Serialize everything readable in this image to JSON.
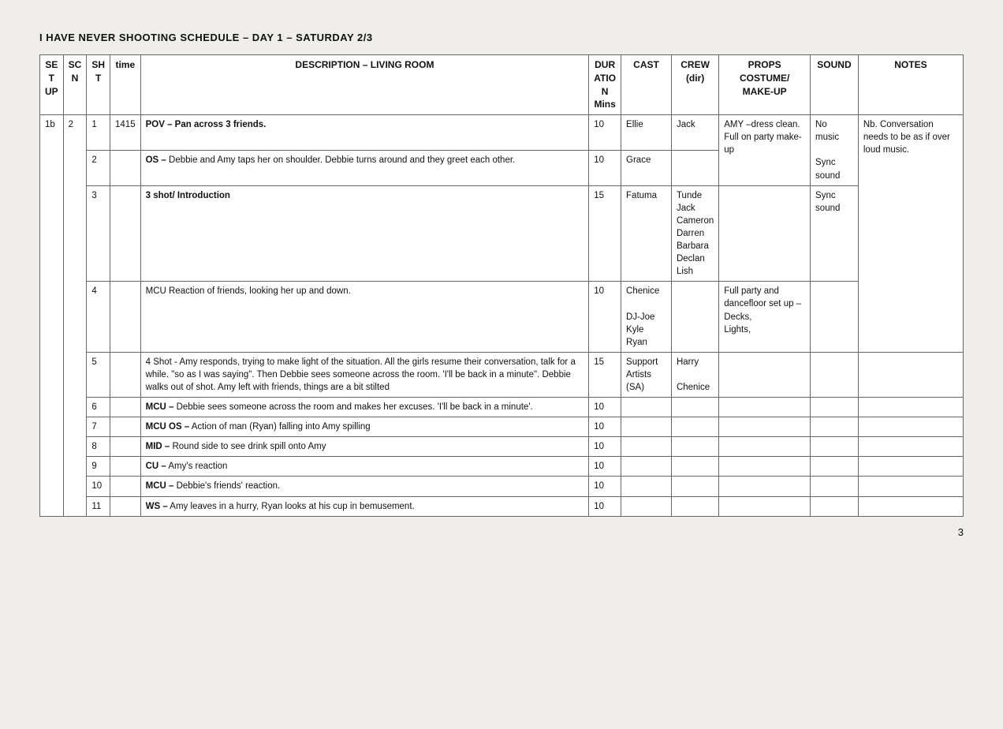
{
  "title": "I HAVE NEVER SHOOTING SCHEDULE – DAY 1 – SATURDAY 2/3",
  "page_number": "3",
  "headers": {
    "se_t_up": "SE\nT\nUP",
    "sc_n": "SC\nN",
    "sh_t": "SH\nT",
    "time": "time",
    "description": "DESCRIPTION – LIVING ROOM",
    "duration": "DUR\nATIO\nN\nMins",
    "cast": "CAST",
    "crew_dir": "CREW\n(dir)",
    "props_costume_makeup": "PROPS\nCOSTUME/\nMAKE-UP",
    "sound": "SOUND",
    "notes": "NOTES"
  },
  "rows": [
    {
      "se": "1b",
      "sc": "2",
      "sh": "1",
      "time": "1415",
      "desc": "POV – Pan across 3 friends.",
      "desc_bold": true,
      "dur": "10",
      "cast": "Ellie",
      "crew": "Jack",
      "props": "AMY –dress clean. Full on party make-up",
      "sound": "No music",
      "notes": "Nb. Conversation needs to be as if over loud music."
    },
    {
      "se": "1b",
      "sc": "2",
      "sh": "2",
      "time": "",
      "desc": "OS – Debbie and Amy taps her on shoulder. Debbie turns around and they greet each other.",
      "desc_bold": false,
      "dur": "10",
      "cast": "Grace",
      "crew": "",
      "props": "",
      "sound": "",
      "notes": ""
    },
    {
      "se": "1b",
      "sc": "2",
      "sh": "3",
      "time": "",
      "desc": "3 shot/ Introduction",
      "desc_bold": true,
      "dur": "15",
      "cast": "Fatuma",
      "crew": "Tunde\nJack\nCameron\nDarren\nBarbara\nDeclan\nLish",
      "props": "",
      "sound": "Sync sound",
      "notes": ""
    },
    {
      "se": "1b",
      "sc": "2",
      "sh": "4",
      "time": "",
      "desc": "MCU Reaction of friends, looking her up and down.",
      "desc_bold": false,
      "dur": "10",
      "cast": "Chenice\n\nDJ-Joe\nKyle\nRyan",
      "crew": "",
      "props": "Full party and dancefloor set up –\nDecks,\nLights,",
      "sound": "",
      "notes": ""
    },
    {
      "se": "1b",
      "sc": "2",
      "sh": "5",
      "time": "",
      "desc": "4 Shot - Amy responds, trying to make light of the situation. All the girls resume their conversation, talk for a while. \"so as I was saying\". Then Debbie sees someone across the room. 'I'll be back in a minute\". Debbie walks out of shot. Amy left with friends, things are a bit stilted",
      "desc_bold": false,
      "dur": "15",
      "cast": "Support Artists\n(SA)",
      "crew": "Harry\n\nChenice",
      "props": "",
      "sound": "",
      "notes": ""
    },
    {
      "se": "1b",
      "sc": "2",
      "sh": "6",
      "time": "",
      "desc": "MCU – Debbie sees someone across the room and makes her excuses. 'I'll be back in a minute'.",
      "desc_bold": false,
      "dur": "10",
      "cast": "",
      "crew": "",
      "props": "",
      "sound": "",
      "notes": ""
    },
    {
      "se": "1b",
      "sc": "2",
      "sh": "7",
      "time": "",
      "desc": "MCU OS – Action of man (Ryan) falling into Amy spilling",
      "desc_bold": false,
      "dur": "10",
      "cast": "",
      "crew": "",
      "props": "",
      "sound": "",
      "notes": ""
    },
    {
      "se": "1b",
      "sc": "2",
      "sh": "8",
      "time": "",
      "desc": "MID – Round side to see drink spill onto Amy",
      "desc_bold": false,
      "dur": "10",
      "cast": "",
      "crew": "",
      "props": "",
      "sound": "",
      "notes": ""
    },
    {
      "se": "1b",
      "sc": "2",
      "sh": "9",
      "time": "",
      "desc": "CU – Amy's reaction",
      "desc_bold": false,
      "dur": "10",
      "cast": "",
      "crew": "",
      "props": "",
      "sound": "",
      "notes": ""
    },
    {
      "se": "1b",
      "sc": "2",
      "sh": "10",
      "time": "",
      "desc": "MCU – Debbie's friends' reaction.",
      "desc_bold": false,
      "dur": "10",
      "cast": "",
      "crew": "",
      "props": "",
      "sound": "",
      "notes": ""
    },
    {
      "se": "1b",
      "sc": "2",
      "sh": "11",
      "time": "",
      "desc": "WS – Amy leaves in a hurry, Ryan looks at his cup in bemusement.",
      "desc_bold": false,
      "dur": "10",
      "cast": "",
      "crew": "",
      "props": "",
      "sound": "",
      "notes": ""
    }
  ]
}
